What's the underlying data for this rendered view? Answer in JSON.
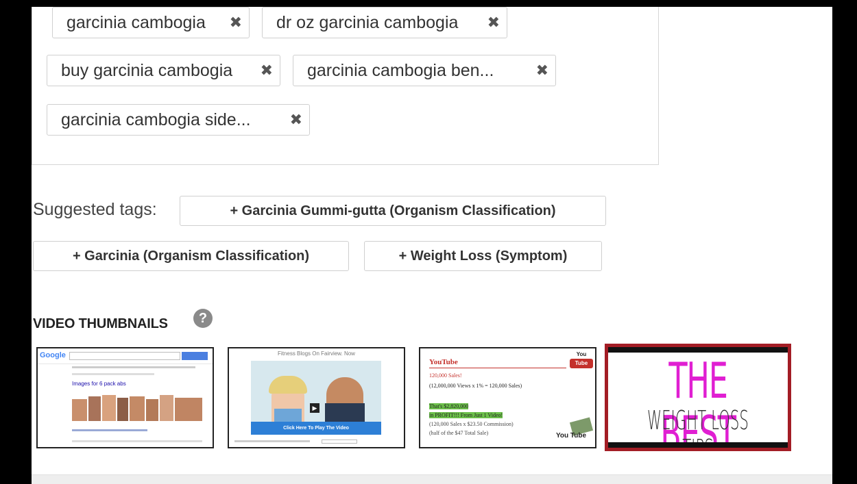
{
  "tags": [
    {
      "label": "garcinia cambogia"
    },
    {
      "label": "dr oz garcinia cambogia"
    },
    {
      "label": "buy garcinia cambogia"
    },
    {
      "label": "garcinia cambogia ben..."
    },
    {
      "label": "garcinia cambogia side..."
    }
  ],
  "remove_glyph": "✖",
  "suggested": {
    "label": "Suggested tags:",
    "items": [
      "+ Garcinia Gummi-gutta (Organism Classification)",
      "+ Garcinia (Organism Classification)",
      "+ Weight Loss (Symptom)"
    ]
  },
  "thumbnails": {
    "title": "VIDEO THUMBNAILS",
    "help_glyph": "?",
    "thumb1": {
      "search_text": "Images for 6 pack abs"
    },
    "thumb2": {
      "top_text": "Fitness Blogs On Fairview. Now",
      "button": "Click Here To Play The Video"
    },
    "thumb3": {
      "brand": "YouTube",
      "line1": "120,000 Sales!",
      "line2": "(12,000,000 Views x 1% = 120,000 Sales)",
      "line3": "That's $2,820,000",
      "line4": "in PROFIT!!! From Just 1 Video!",
      "line5": "(120,000 Sales x $23.50 Commission)",
      "line6": "(half of the $47 Total Sale)",
      "badge": "You Tube"
    },
    "thumb4": {
      "big": "THE BEST",
      "small": "WEIGHT LOSS TIPS"
    }
  },
  "colors": {
    "thumb4_border": "#a31d25",
    "thumb4_title": "#e01fd2",
    "youtube_red": "#c4302b"
  }
}
